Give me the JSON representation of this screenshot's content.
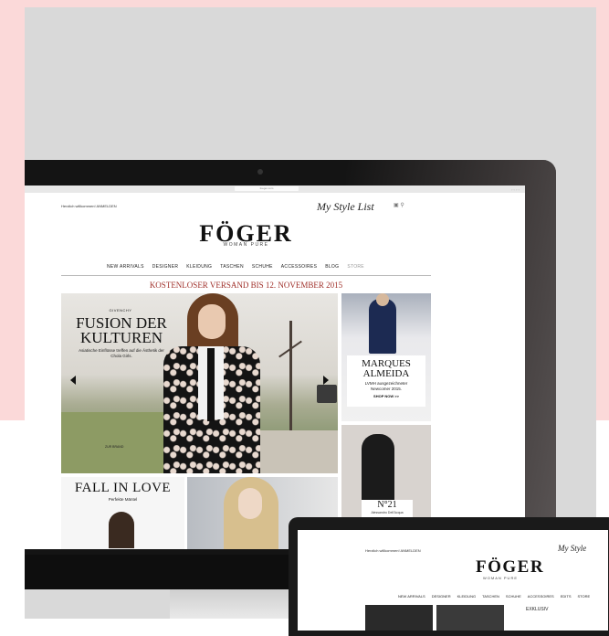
{
  "site": {
    "welcome": "Herzlich willkommen! ANMELDEN",
    "url": "foeger.com",
    "my_style_list": "My Style List",
    "logo": "FÖGER",
    "logo_sub": "WOMAN PURE",
    "nav": [
      "NEW ARRIVALS",
      "DESIGNER",
      "KLEIDUNG",
      "TASCHEN",
      "SCHUHE",
      "ACCESSOIRES",
      "BLOG",
      "STORE"
    ],
    "promo": "KOSTENLOSER VERSAND BIS 12. NOVEMBER 2015"
  },
  "hero": {
    "brand": "GIVENCHY",
    "title_line1": "FUSION DER",
    "title_line2": "KULTUREN",
    "text": "Asiatische Einflüsse treffen auf die Ästhetik der Chola Girls.",
    "cta": "ZUR BRAND"
  },
  "side1": {
    "title_line1": "MARQUES",
    "title_line2": "ALMEIDA",
    "text_line1": "LVMH ausgezeichneter",
    "text_line2": "Newcomer 2015.",
    "cta": "SHOP NOW >>"
  },
  "side2": {
    "title": "N°21",
    "text": "Alessandro Dell'Acqua"
  },
  "fall": {
    "title": "FALL IN LOVE",
    "subtitle": "Perfekte Mäntel"
  },
  "laptop": {
    "welcome": "Herzlich willkommen! ANMELDEN",
    "my_style": "My Style",
    "logo": "FÖGER",
    "logo_sub": "WOMAN PURE",
    "nav": [
      "NEW ARRIVALS",
      "DESIGNER",
      "KLEIDUNG",
      "TASCHEN",
      "SCHUHE",
      "ACCESSOIRES",
      "EDITS",
      "STORE"
    ],
    "promo": "EXKLUSIV"
  },
  "icons": {
    "bag": "bag-icon",
    "search": "search-icon",
    "arrow_left": "arrow-left-icon",
    "arrow_right": "arrow-right-icon"
  },
  "colors": {
    "promo": "#a0302a",
    "pink_background": "#fbd9d9",
    "grey_panel": "#d9d9d9"
  }
}
